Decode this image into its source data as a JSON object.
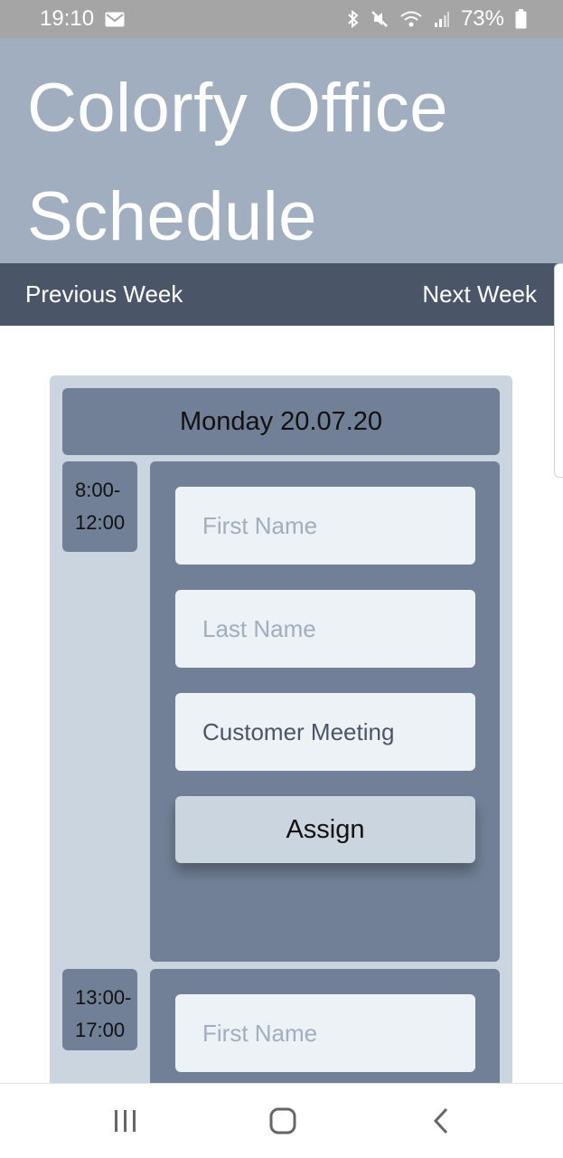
{
  "status_bar": {
    "time": "19:10",
    "battery_percent": "73%",
    "icons_left": [
      "mail-icon"
    ],
    "icons_right": [
      "bluetooth-icon",
      "mute-icon",
      "wifi-icon",
      "signal-icon",
      "battery-icon"
    ]
  },
  "header": {
    "title_line1": "Colorfy Office",
    "title_line2": "Schedule"
  },
  "nav": {
    "previous": "Previous Week",
    "next": "Next Week"
  },
  "day": {
    "label": "Monday 20.07.20",
    "slots": [
      {
        "time_start": "8:00-",
        "time_end": "12:00",
        "first_name_placeholder": "First Name",
        "last_name_placeholder": "Last Name",
        "topic_value": "Customer Meeting",
        "assign_label": "Assign"
      },
      {
        "time_start": "13:00-",
        "time_end": "17:00",
        "first_name_placeholder": "First Name"
      }
    ]
  },
  "system_nav": {
    "icons": [
      "recent-apps-icon",
      "home-icon",
      "back-icon"
    ]
  },
  "colors": {
    "header_bg": "#a0aec0",
    "nav_bg": "#4a5568",
    "card_bg": "#cbd5e0",
    "panel_bg": "#718096",
    "field_bg": "#edf2f7"
  }
}
